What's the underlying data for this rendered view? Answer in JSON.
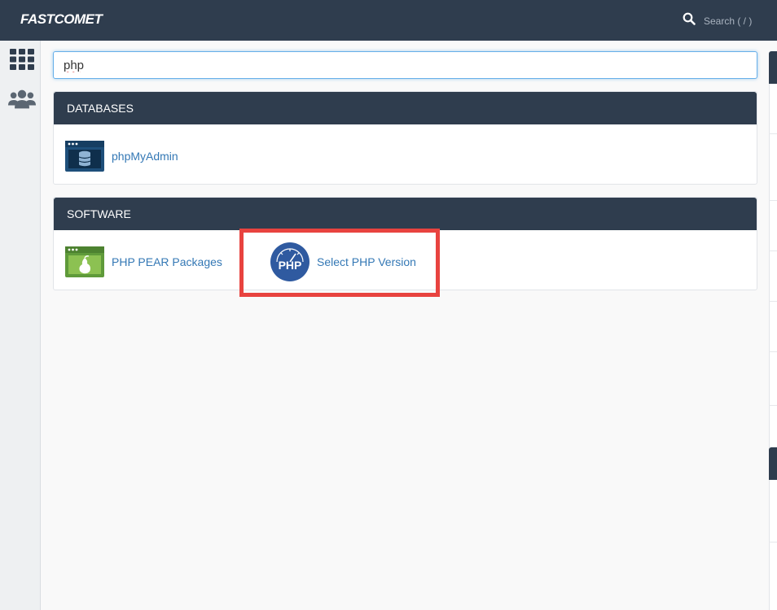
{
  "header": {
    "logo": "FASTCOMET",
    "search_label": "Search ( / )"
  },
  "icons": {
    "search": "search-icon",
    "apps_grid": "grid-icon",
    "users": "users-icon"
  },
  "search": {
    "value": "php"
  },
  "sections": [
    {
      "title": "DATABASES",
      "items": [
        {
          "label": "phpMyAdmin",
          "icon": "database-window-icon"
        }
      ]
    },
    {
      "title": "SOFTWARE",
      "items": [
        {
          "label": "PHP PEAR Packages",
          "icon": "pear-window-icon"
        },
        {
          "label": "Select PHP Version",
          "icon": "php-gauge-icon"
        }
      ]
    }
  ],
  "colors": {
    "header_bg": "#2f3d4e",
    "link": "#3478b5",
    "highlight": "#e8433f"
  }
}
